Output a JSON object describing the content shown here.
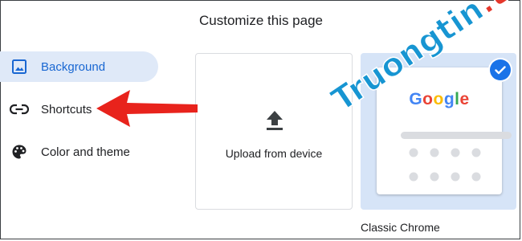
{
  "dialog": {
    "title": "Customize this page"
  },
  "nav": {
    "items": [
      {
        "label": "Background",
        "icon": "image-icon",
        "active": true
      },
      {
        "label": "Shortcuts",
        "icon": "link-icon",
        "active": false
      },
      {
        "label": "Color and theme",
        "icon": "palette-icon",
        "active": false
      }
    ]
  },
  "tiles": {
    "upload": {
      "label": "Upload from device",
      "icon": "upload-icon"
    },
    "classic": {
      "label": "Classic Chrome",
      "logo": "Google",
      "selected": true
    }
  },
  "annotation": {
    "arrow_color": "#e8231c",
    "arrow_target": "Shortcuts"
  },
  "watermark": {
    "text_a": "Truongtin",
    "text_b": ".top",
    "color_a": "#1795d2",
    "color_b": "#e5372b"
  },
  "colors": {
    "accent": "#1a73e8",
    "active_bg": "#dfe9f8",
    "tile_bg": "#d6e4f7"
  }
}
